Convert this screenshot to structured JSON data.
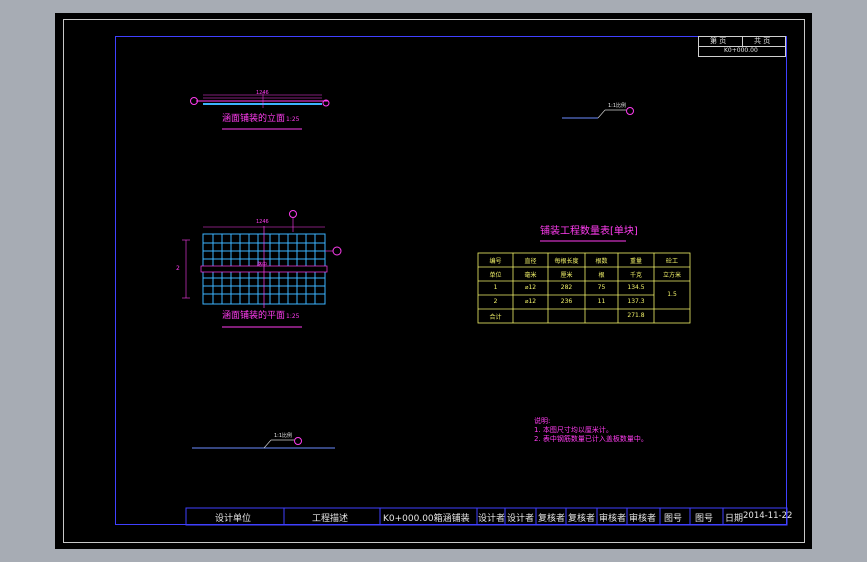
{
  "header_box": {
    "sheet_no_label": "第 页",
    "sheet_total_label": "共 页",
    "drawing_code": "K0+000.00"
  },
  "elevation": {
    "caption": "涵面铺装的立面",
    "scale": "1:25",
    "dim": "1246"
  },
  "plan": {
    "caption": "涵面铺装的平面",
    "scale": "1:25",
    "dim_top": "1246",
    "dim_side": "2",
    "label_center": "路中"
  },
  "side_note_small": "1:1比例",
  "bottom_note_small": "1:1比例",
  "table": {
    "title": "铺装工程数量表[单块]",
    "headers": [
      "编号",
      "直径",
      "每根长度",
      "根数",
      "重量",
      "砼工"
    ],
    "units": [
      "单位",
      "毫米",
      "厘米",
      "根",
      "千克",
      "立方米"
    ],
    "rows": [
      [
        "1",
        "⌀12",
        "282",
        "75",
        "134.5",
        ""
      ],
      [
        "2",
        "⌀12",
        "236",
        "11",
        "137.3",
        "1.5"
      ],
      [
        "合计",
        "",
        "",
        "",
        "271.8",
        ""
      ]
    ]
  },
  "notes": {
    "heading": "说明:",
    "line1": "1. 本图尺寸均以厘米计。",
    "line2": "2. 表中钢筋数量已计入盖板数量中。"
  },
  "title_block": {
    "design_unit": "设计单位",
    "project": "工程描述",
    "drawing_title": "K0+000.00箱涵铺装",
    "designer": "设计者",
    "designer2": "设计者",
    "checker": "复核者",
    "checker2": "复核者",
    "reviewer": "审核者",
    "reviewer2": "审核者",
    "fig_no": "图号",
    "fig_no2": "图号",
    "date_label": "日期",
    "date": "2014-11-22"
  },
  "colors": {
    "sheet": "#000000",
    "backdrop": "#a7acb4",
    "frame": "#4040ff",
    "annotation": "#ff3cf0",
    "table": "#f3f36a",
    "rebar": "#3cb4ff"
  }
}
